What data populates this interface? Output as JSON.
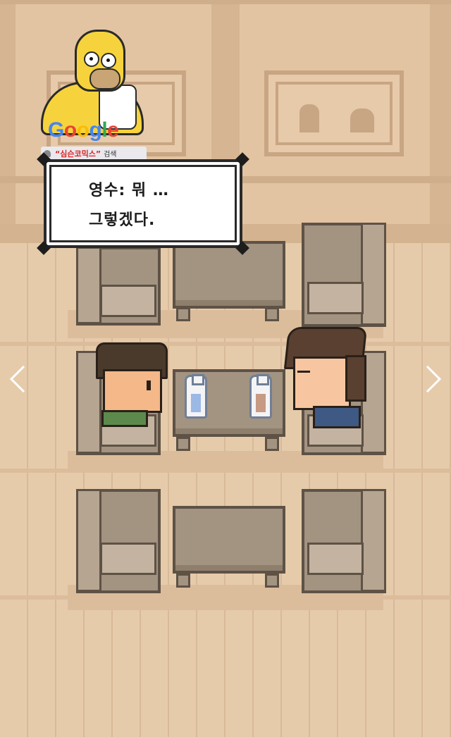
{
  "dialog": {
    "line1": "영수: 뭐 …",
    "line2": "그렇겠다."
  },
  "ad": {
    "brand_letters": [
      {
        "char": "G",
        "color": "#4285f4"
      },
      {
        "char": "o",
        "color": "#ea4335"
      },
      {
        "char": "o",
        "color": "#fbbc05"
      },
      {
        "char": "g",
        "color": "#4285f4"
      },
      {
        "char": "l",
        "color": "#34a853"
      },
      {
        "char": "e",
        "color": "#ea4335"
      }
    ],
    "query": "“심슨코믹스”",
    "search_label": "검색"
  },
  "nav": {
    "prev_icon": "chevron-left-icon",
    "next_icon": "chevron-right-icon"
  },
  "colors": {
    "wall": "#e2c4a2",
    "floor": "#e6cbab",
    "furniture": "#a39381",
    "outline": "#5e5245"
  }
}
